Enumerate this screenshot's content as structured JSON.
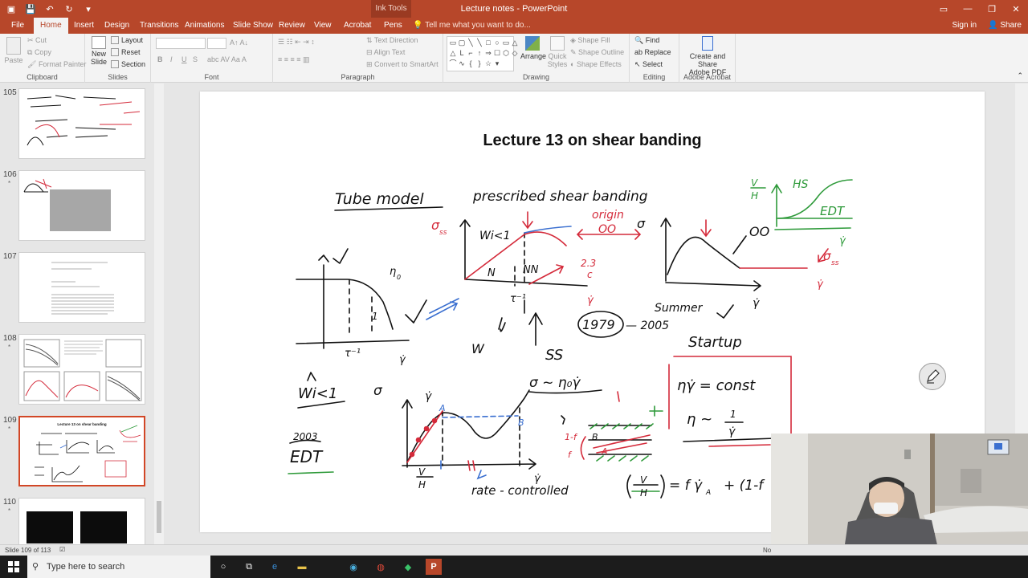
{
  "titlebar": {
    "title": "Lecture notes - PowerPoint",
    "context_tab": "Ink Tools"
  },
  "tabs": {
    "items": [
      "File",
      "Home",
      "Insert",
      "Design",
      "Transitions",
      "Animations",
      "Slide Show",
      "Review",
      "View",
      "Acrobat",
      "Pens"
    ],
    "active": "Home",
    "tell_me": "Tell me what you want to do...",
    "sign_in": "Sign in",
    "share": "Share"
  },
  "ribbon": {
    "clipboard": {
      "paste": "Paste",
      "cut": "Cut",
      "copy": "Copy",
      "format_painter": "Format Painter",
      "label": "Clipboard"
    },
    "slides": {
      "new_slide_1": "New",
      "new_slide_2": "Slide",
      "layout": "Layout",
      "reset": "Reset",
      "section": "Section",
      "label": "Slides"
    },
    "font": {
      "bold": "B",
      "italic": "I",
      "underline": "U",
      "strike": "S",
      "label": "Font"
    },
    "paragraph": {
      "text_direction": "Text Direction",
      "align_text": "Align Text",
      "convert_smartart": "Convert to SmartArt",
      "label": "Paragraph"
    },
    "drawing": {
      "arrange": "Arrange",
      "quick_styles_1": "Quick",
      "quick_styles_2": "Styles",
      "shape_fill": "Shape Fill",
      "shape_outline": "Shape Outline",
      "shape_effects": "Shape Effects",
      "label": "Drawing"
    },
    "editing": {
      "find": "Find",
      "replace": "Replace",
      "select": "Select",
      "label": "Editing"
    },
    "acrobat": {
      "create_share_1": "Create and Share",
      "create_share_2": "Adobe PDF",
      "label": "Adobe Acrobat"
    }
  },
  "thumbnails": [
    {
      "number": "105",
      "star": ""
    },
    {
      "number": "106",
      "star": "*"
    },
    {
      "number": "107",
      "star": ""
    },
    {
      "number": "108",
      "star": "*"
    },
    {
      "number": "109",
      "star": "*"
    },
    {
      "number": "110",
      "star": "*"
    }
  ],
  "thumb_texts": {
    "t109_title": "Lecture 13 on shear banding"
  },
  "slide": {
    "title": "Lecture 13 on shear banding",
    "ink": {
      "tube_model": "Tube model",
      "prescribed": "prescribed shear banding",
      "wi1": "Wi<1",
      "N": "N",
      "NN": "NN",
      "origin": "origin",
      "OO": "OO",
      "ratio": "2.3",
      "ratio_den": "c",
      "sigma_ss": "σ",
      "sigma_ss_sub": "ss",
      "eta0": "η",
      "eta0_sub": "0",
      "tau_inv": "τ⁻¹",
      "W": "W",
      "SS": "SS",
      "year1979": "1979",
      "year2005": "— 2005",
      "summer": "Summer",
      "HS": "HS",
      "EDT_top": "EDT",
      "VH": "V",
      "VH_den": "H",
      "startup": "Startup",
      "eta_gamma": "ηγ̇ = const",
      "eta_approx": "η ~",
      "one": "1",
      "gamma_dot": "γ̇",
      "wi1_bottom": "Wi<1",
      "sigma": "σ",
      "year2003": "2003",
      "EDT_bottom": "EDT",
      "sigma_eta": "σ ~ η₀γ̇",
      "A": "A",
      "B": "B",
      "rate_controlled": "rate - controlled",
      "one_minus_f": "1-f",
      "f": "f",
      "lever": "= f γ̇",
      "lever_sub": "A",
      "lever_tail": "+ (1-f",
      "rc": "r",
      "d": "d"
    }
  },
  "status": {
    "slide_info": "Slide 109 of 113",
    "notes": "No"
  },
  "taskbar": {
    "search_placeholder": "Type here to search"
  },
  "colors": {
    "accent": "#b7472a",
    "ink_black": "#111111",
    "ink_red": "#d42a3a",
    "ink_green": "#2e9a3a",
    "ink_blue": "#3a6fd0"
  }
}
